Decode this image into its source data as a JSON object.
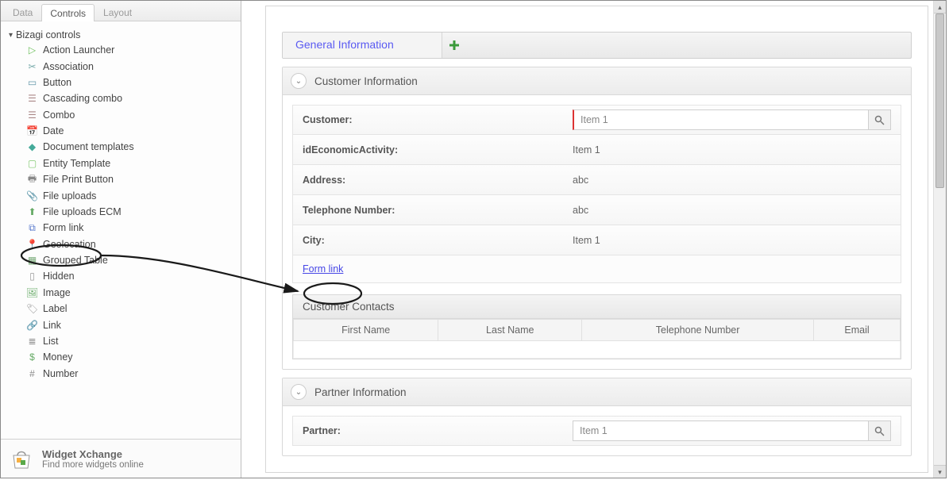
{
  "tabs": {
    "data": "Data",
    "controls": "Controls",
    "layout": "Layout"
  },
  "tree": {
    "root": "Bizagi controls",
    "items": [
      "Action Launcher",
      "Association",
      "Button",
      "Cascading combo",
      "Combo",
      "Date",
      "Document templates",
      "Entity Template",
      "File Print Button",
      "File uploads",
      "File uploads ECM",
      "Form link",
      "Geolocation",
      "Grouped Table",
      "Hidden",
      "Image",
      "Label",
      "Link",
      "List",
      "Money",
      "Number"
    ]
  },
  "widget": {
    "title": "Widget Xchange",
    "sub": "Find more widgets online"
  },
  "main": {
    "tab": "General Information",
    "group1": {
      "title": "Customer Information",
      "rows": {
        "customer_label": "Customer:",
        "customer_value": "Item 1",
        "activity_label": "idEconomicActivity:",
        "activity_value": "Item 1",
        "address_label": "Address:",
        "address_value": "abc",
        "tel_label": "Telephone Number:",
        "tel_value": "abc",
        "city_label": "City:",
        "city_value": "Item 1"
      },
      "formlink": "Form link",
      "contacts": {
        "title": "Customer Contacts",
        "cols": [
          "First Name",
          "Last Name",
          "Telephone Number",
          "Email"
        ]
      }
    },
    "group2": {
      "title": "Partner Information",
      "partner_label": "Partner:",
      "partner_value": "Item 1"
    }
  }
}
